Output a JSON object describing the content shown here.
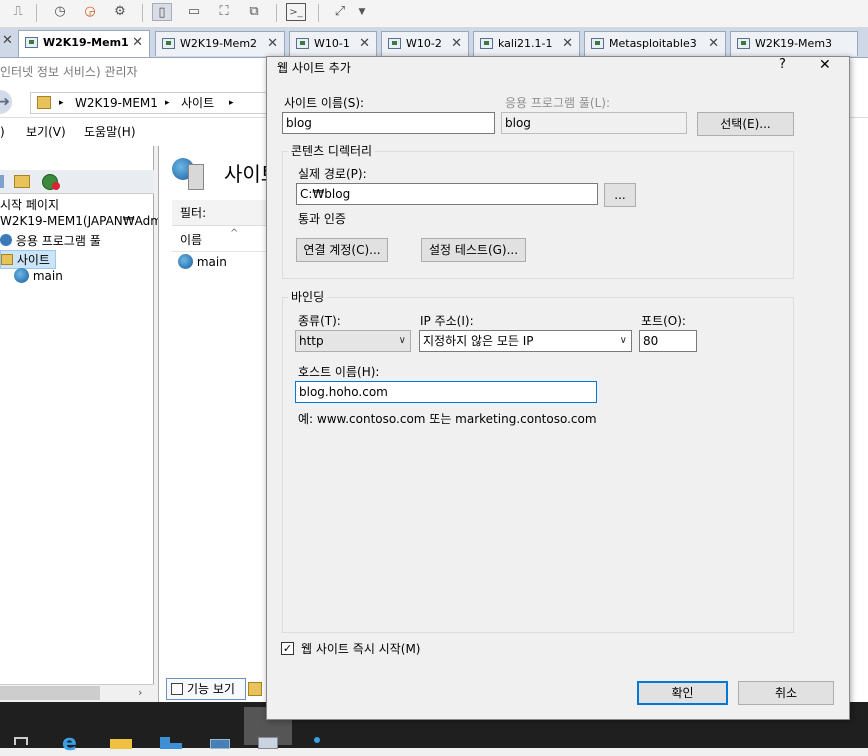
{
  "tabs": [
    {
      "label": "W2K19-Mem1",
      "active": true
    },
    {
      "label": "W2K19-Mem2",
      "active": false
    },
    {
      "label": "W10-1",
      "active": false
    },
    {
      "label": "W10-2",
      "active": false
    },
    {
      "label": "kali21.1-1",
      "active": false
    },
    {
      "label": "Metasploitable3",
      "active": false
    },
    {
      "label": "W2K19-Mem3",
      "active": false
    }
  ],
  "iis": {
    "title": "인터넷 정보 서비스) 관리자",
    "breadcrumb": {
      "server": "W2K19-MEM1",
      "sep": "▸",
      "node": "사이트"
    },
    "menu": {
      "view": "보기(V)",
      "help": "도움말(H)",
      "first": ")"
    },
    "tree": {
      "start_page": "시작 페이지",
      "server": "W2K19-MEM1(JAPAN₩Adm",
      "app_pools": "응용 프로그램 풀",
      "sites": "사이트",
      "main": "main"
    },
    "content": {
      "heading": "사이트",
      "filter_label": "필터:",
      "col_name": "이름",
      "row_main": "main",
      "feature_view": "기능 보기"
    }
  },
  "dialog": {
    "title": "웹 사이트 추가",
    "help": "?",
    "close": "✕",
    "site_name_label": "사이트 이름(S):",
    "site_name_value": "blog",
    "app_pool_label": "응용 프로그램 풀(L):",
    "app_pool_value": "blog",
    "select_button": "선택(E)...",
    "content_dir_title": "콘텐츠 디렉터리",
    "physical_path_label": "실제 경로(P):",
    "physical_path_value": "C:₩blog",
    "browse_button": "...",
    "pass_auth_label": "통과 인증",
    "connect_as_button": "연결 계정(C)...",
    "test_settings_button": "설정 테스트(G)...",
    "binding_title": "바인딩",
    "type_label": "종류(T):",
    "type_value": "http",
    "ip_label": "IP 주소(I):",
    "ip_value": "지정하지 않은 모든 IP",
    "port_label": "포트(O):",
    "port_value": "80",
    "host_label": "호스트 이름(H):",
    "host_value": "blog.hoho.com",
    "example_text": "예: www.contoso.com 또는 marketing.contoso.com",
    "start_now_label": "웹 사이트 즉시 시작(M)",
    "start_now_checked": true,
    "ok_button": "확인",
    "cancel_button": "취소"
  }
}
